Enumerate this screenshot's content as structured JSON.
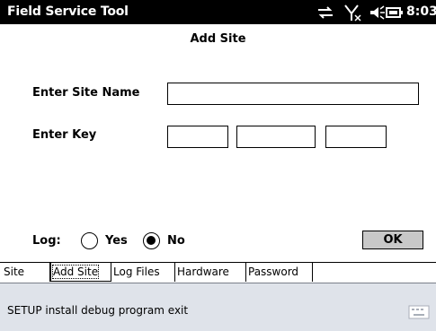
{
  "titlebar": {
    "app_title": "Field Service Tool",
    "clock": "8:03",
    "icons": [
      "sync-icon",
      "signal-icon",
      "volume-icon",
      "battery-icon"
    ]
  },
  "page": {
    "title": "Add Site"
  },
  "form": {
    "site_name_label": "Enter Site Name",
    "site_name_value": "",
    "key_label": "Enter Key",
    "key_values": [
      "",
      "",
      ""
    ],
    "log_label": "Log:",
    "log_options": [
      {
        "label": "Yes",
        "selected": false
      },
      {
        "label": "No",
        "selected": true
      }
    ],
    "ok_label": "OK"
  },
  "tabs": [
    {
      "label": "Site",
      "active": false
    },
    {
      "label": "Add Site",
      "active": true
    },
    {
      "label": "Log Files",
      "active": false
    },
    {
      "label": "Hardware",
      "active": false
    },
    {
      "label": "Password",
      "active": false
    }
  ],
  "menubar": {
    "text": "SETUP install debug program exit",
    "icon": "keyboard-icon"
  }
}
